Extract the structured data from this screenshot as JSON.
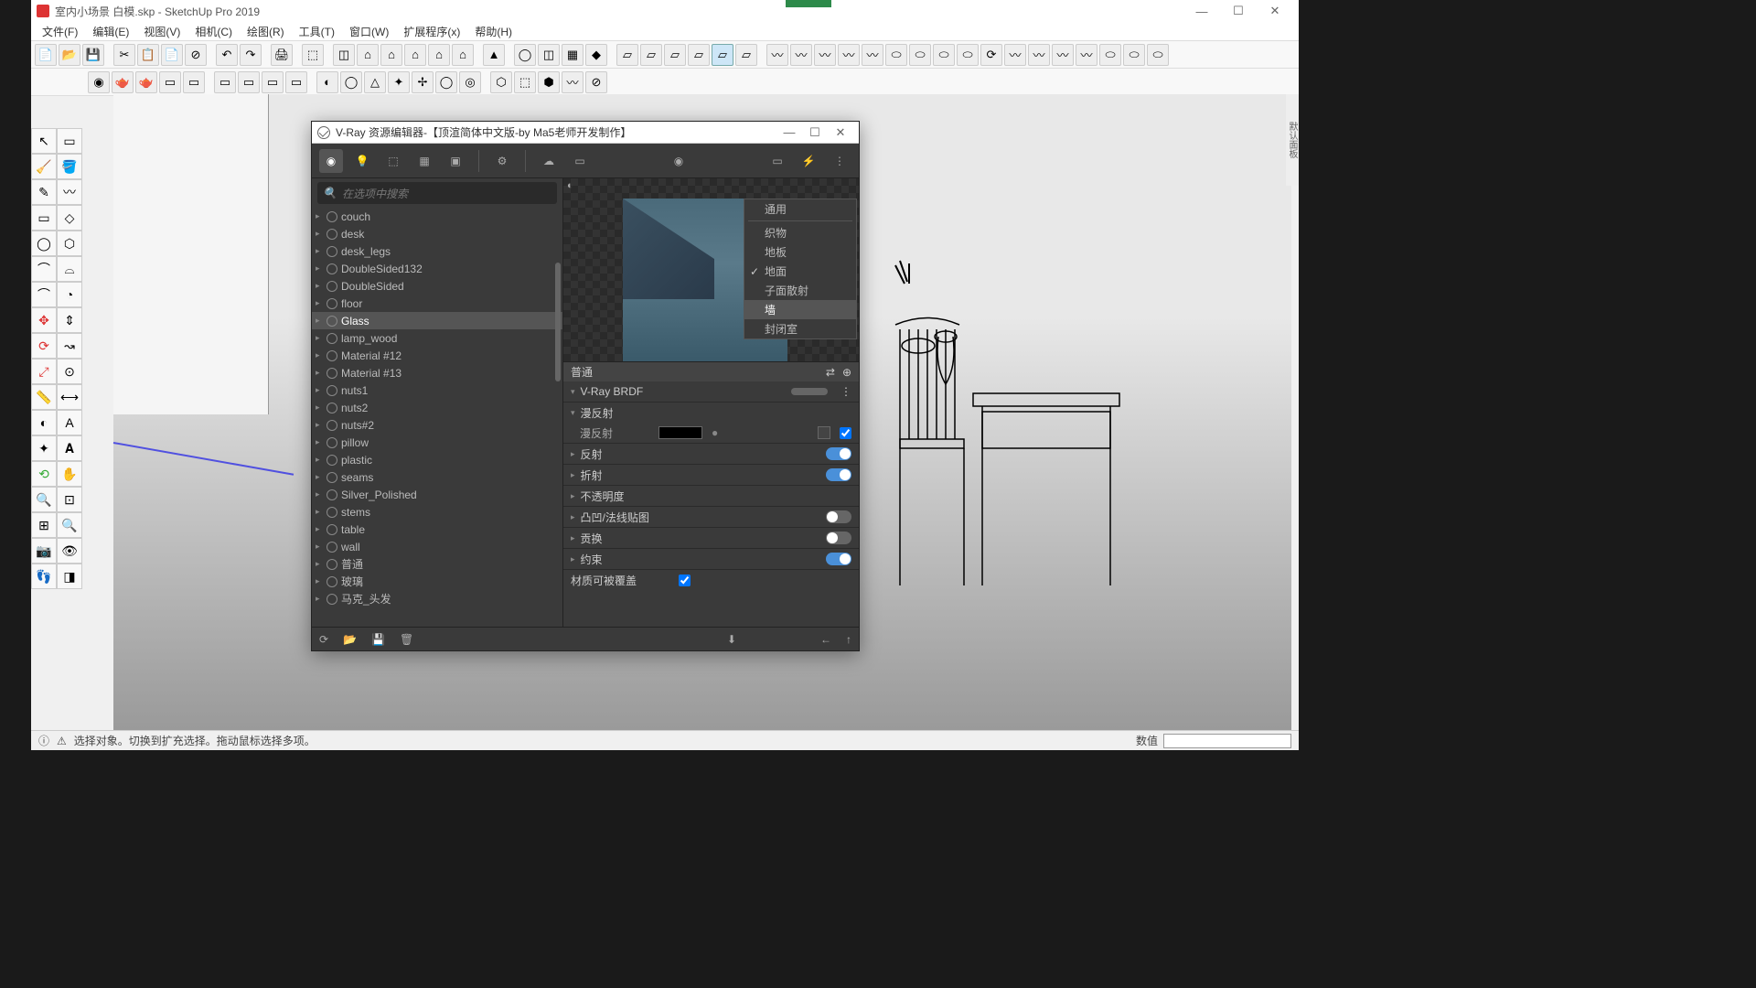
{
  "app": {
    "title": "室内小场景 白模.skp - SketchUp Pro 2019"
  },
  "menu": {
    "file": "文件(F)",
    "edit": "编辑(E)",
    "view": "视图(V)",
    "camera": "相机(C)",
    "draw": "绘图(R)",
    "tools": "工具(T)",
    "window": "窗口(W)",
    "ext": "扩展程序(x)",
    "help": "帮助(H)"
  },
  "status": {
    "hint": "选择对象。切换到扩充选择。拖动鼠标选择多项。",
    "value_label": "数值"
  },
  "vray": {
    "title": "V-Ray 资源编辑器-【顶渲简体中文版-by Ma5老师开发制作】",
    "search_placeholder": "在选项中搜索",
    "materials": [
      "couch",
      "desk",
      "desk_legs",
      "DoubleSided132",
      "DoubleSided",
      "floor",
      "Glass",
      "lamp_wood",
      "Material #12",
      "Material #13",
      "nuts1",
      "nuts2",
      "nuts#2",
      "pillow",
      "plastic",
      "seams",
      "Silver_Polished",
      "stems",
      "table",
      "wall",
      "普通",
      "玻璃",
      "马克_头发"
    ],
    "selected_material_index": 6,
    "context_menu": {
      "items": [
        "通用",
        "织物",
        "地板",
        "地面",
        "子面散射",
        "墙",
        "封闭室"
      ],
      "checked_index": 3,
      "hover_index": 5
    },
    "props": {
      "header": "普通",
      "brdf": "V-Ray BRDF",
      "sections": {
        "diffuse": "漫反射",
        "diffuse_row": "漫反射",
        "reflection": "反射",
        "refraction": "折射",
        "opacity": "不透明度",
        "bump": "凸凹/法线贴图",
        "displace": "贡换",
        "bind": "约束",
        "override": "材质可被覆盖"
      }
    }
  }
}
